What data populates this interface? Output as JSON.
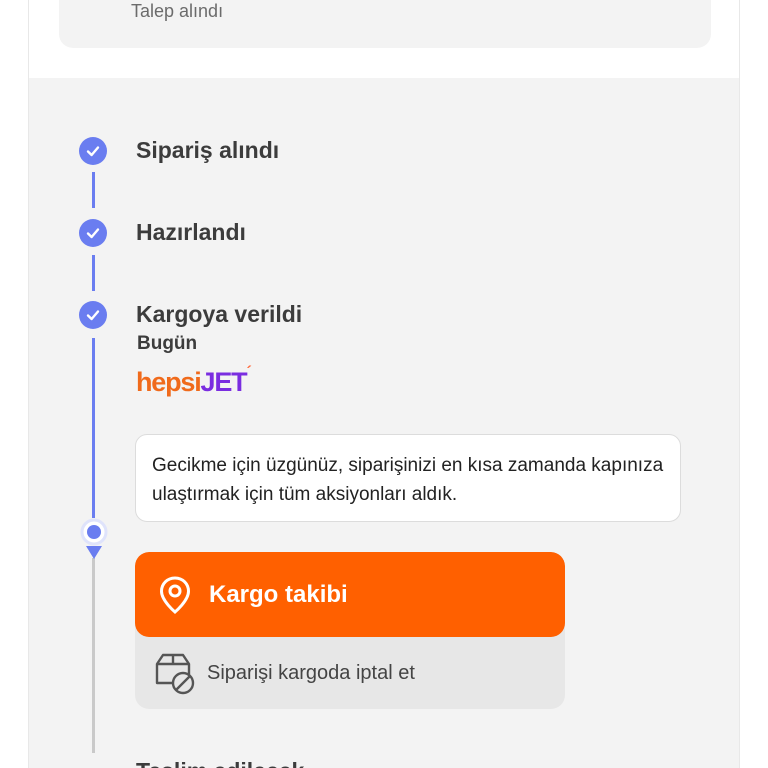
{
  "request": {
    "status": "Talep alındı"
  },
  "steps": [
    {
      "title": "Sipariş alındı",
      "done": true
    },
    {
      "title": "Hazırlandı",
      "done": true
    },
    {
      "title": "Kargoya verildi",
      "date": "Bugün",
      "done": true
    }
  ],
  "carrier": {
    "logo_part1": "hepsi",
    "logo_part2": "JET",
    "logo_mark": "´"
  },
  "message": "Gecikme için üzgünüz, siparişinizi en kısa zamanda kapınıza ulaştırmak için tüm aksiyonları aldık.",
  "actions": {
    "track_label": "Kargo takibi",
    "cancel_label": "Siparişi kargoda iptal et"
  },
  "next_step": {
    "title": "Teslim edilecek"
  },
  "colors": {
    "timeline_blue": "#6a7df0",
    "primary_orange": "#ff6000",
    "brand_purple": "#7a2de0"
  },
  "icons": {
    "check": "check-icon",
    "current": "current-step-marker-icon",
    "pin": "location-pin-icon",
    "cancel": "box-cancel-icon"
  }
}
